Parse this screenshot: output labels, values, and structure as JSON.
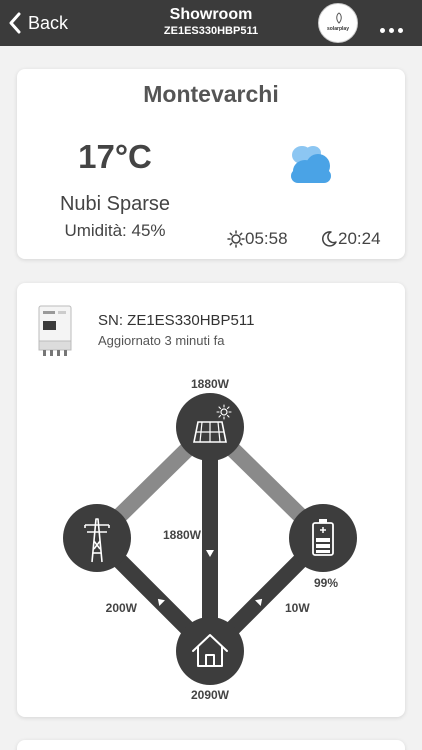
{
  "header": {
    "back_label": "Back",
    "title": "Showroom",
    "subtitle": "ZE1ES330HBP511",
    "logo_text": "solarplay"
  },
  "weather": {
    "city": "Montevarchi",
    "temperature": "17°C",
    "condition": "Nubi Sparse",
    "humidity": "Umidità: 45%",
    "sunrise": "05:58",
    "sunset": "20:24"
  },
  "device": {
    "serial": "SN: ZE1ES330HBP511",
    "updated": "Aggiornato 3 minuti fa"
  },
  "flow": {
    "solar_power": "1880W",
    "solar_to_home": "1880W",
    "grid_power": "200W",
    "battery_power": "10W",
    "battery_soc": "99%",
    "home_power": "2090W"
  },
  "colors": {
    "header_bg": "#3b3b3b",
    "node": "#3d3d3d",
    "line_active": "#3d3d3d",
    "line_inactive": "#8a8a8a",
    "cloud": "#4aa3e6"
  }
}
